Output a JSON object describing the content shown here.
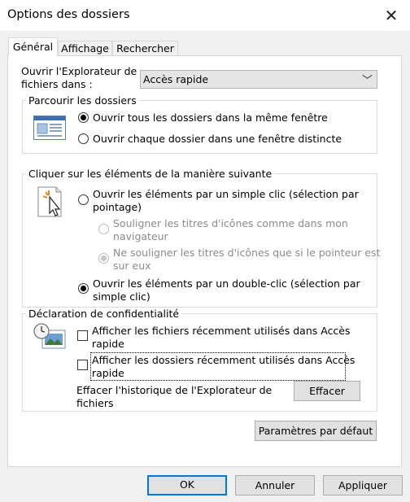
{
  "window": {
    "title": "Options des dossiers",
    "close_glyph": "✕"
  },
  "tabs": [
    {
      "label": "Général",
      "active": true
    },
    {
      "label": "Affichage",
      "active": false
    },
    {
      "label": "Rechercher",
      "active": false
    }
  ],
  "open_in": {
    "label_line1": "Ouvrir l'Explorateur de",
    "label_line2": "fichiers dans :",
    "selected": "Accès rapide",
    "chevron": "﹀"
  },
  "browse": {
    "legend": "Parcourir les dossiers",
    "icon": "folder-window-icon",
    "options": [
      {
        "label": "Ouvrir tous les dossiers dans la même fenêtre",
        "checked": true
      },
      {
        "label": "Ouvrir chaque dossier dans une fenêtre distincte",
        "checked": false
      }
    ]
  },
  "click": {
    "legend": "Cliquer sur les éléments de la manière suivante",
    "icon": "click-cursor-icon",
    "single": {
      "line1": "Ouvrir les éléments par un simple clic (sélection par",
      "line2": "pointage)",
      "checked": false
    },
    "sub_underline_always": {
      "line1": "Souligner les titres d'icônes comme dans mon",
      "line2": "navigateur",
      "checked": false,
      "disabled": true
    },
    "sub_underline_hover": {
      "line1": "Ne souligner les titres d'icônes que si le pointeur est",
      "line2": "sur eux",
      "checked": true,
      "disabled": true
    },
    "double": {
      "line1": "Ouvrir les éléments par un double-clic (sélection par",
      "line2": "simple clic)",
      "checked": true
    }
  },
  "privacy": {
    "legend": "Déclaration de confidentialité",
    "icon": "privacy-clock-icon",
    "recent_files": {
      "line1": "Afficher les fichiers récemment utilisés dans Accès",
      "line2": "rapide",
      "checked": false
    },
    "recent_folders": {
      "line1": "Afficher les dossiers récemment utilisés dans Accès",
      "line2": "rapide",
      "checked": false
    },
    "clear_label_line1": "Effacer l'historique de l'Explorateur de",
    "clear_label_line2": "fichiers",
    "clear_button": "Effacer"
  },
  "defaults_button": "Paramètres par défaut",
  "footer": {
    "ok": "OK",
    "cancel": "Annuler",
    "apply": "Appliquer"
  }
}
